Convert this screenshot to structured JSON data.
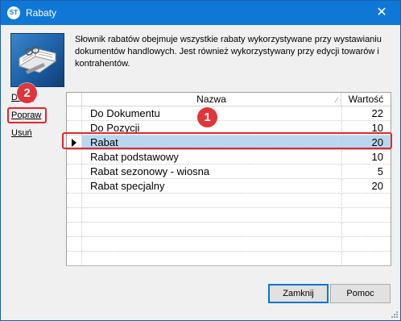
{
  "window": {
    "title": "Rabaty",
    "app_icon_text": "ST",
    "close_glyph": "✕"
  },
  "description": "Słownik rabatów obejmuje wszystkie rabaty wykorzystywane przy wystawianiu dokumentów handlowych. Jest również wykorzystywany przy edycji towarów i kontrahentów.",
  "side_links": {
    "add": "Dodaj",
    "edit": "Popraw",
    "delete": "Usuń"
  },
  "annotations": {
    "badge_1": "1",
    "badge_2": "2",
    "highlight_color": "#e2262b"
  },
  "grid": {
    "headers": {
      "name": "Nazwa",
      "value": "Wartość",
      "sort_glyph": "⁄"
    },
    "selected_index": 2,
    "rows": [
      {
        "name": "Do Dokumentu",
        "value": "22"
      },
      {
        "name": "Do Pozycji",
        "value": "10"
      },
      {
        "name": "Rabat",
        "value": "20"
      },
      {
        "name": "Rabat podstawowy",
        "value": "10"
      },
      {
        "name": "Rabat sezonowy - wiosna",
        "value": "5"
      },
      {
        "name": "Rabat specjalny",
        "value": "20"
      },
      {
        "name": "",
        "value": ""
      },
      {
        "name": "",
        "value": ""
      },
      {
        "name": "",
        "value": ""
      },
      {
        "name": "",
        "value": ""
      },
      {
        "name": "",
        "value": ""
      }
    ],
    "selection_color": "#b9d7ef"
  },
  "buttons": {
    "close": "Zamknij",
    "help": "Pomoc"
  },
  "colors": {
    "titlebar": "#0f78d7",
    "accent": "#0078d7"
  }
}
